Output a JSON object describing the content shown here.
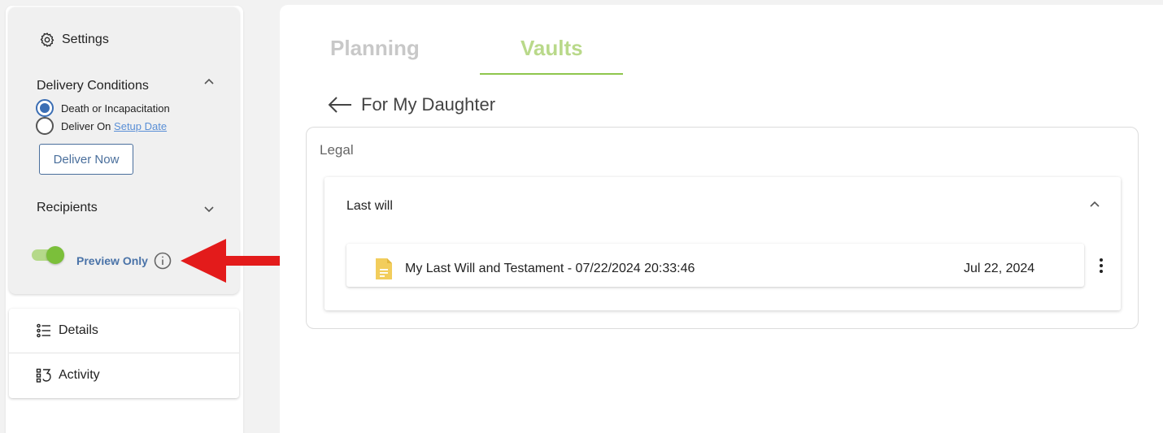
{
  "sidebar": {
    "settings_label": "Settings",
    "delivery_conditions": {
      "title": "Delivery Conditions",
      "options": [
        {
          "label": "Death or Incapacitation",
          "selected": true
        },
        {
          "label": "Deliver On",
          "link_label": "Setup Date",
          "selected": false
        }
      ],
      "deliver_now_label": "Deliver Now"
    },
    "recipients_label": "Recipients",
    "preview_toggle": {
      "label": "Preview Only",
      "on": true
    },
    "nav": [
      {
        "label": "Details",
        "icon": "details-list-icon"
      },
      {
        "label": "Activity",
        "icon": "activity-icon"
      }
    ]
  },
  "main": {
    "tabs": [
      {
        "label": "Planning",
        "active": false
      },
      {
        "label": "Vaults",
        "active": true
      }
    ],
    "vault_title": "For My Daughter",
    "section": {
      "title": "Legal",
      "category": {
        "title": "Last will",
        "files": [
          {
            "name": "My Last Will and Testament - 07/22/2024 20:33:46",
            "date": "Jul 22, 2024",
            "icon": "document-icon"
          }
        ]
      }
    }
  },
  "colors": {
    "accent_green": "#8fc64d",
    "link_blue": "#5a8fd6",
    "button_blue": "#4a6f9c",
    "annotation_red": "#e31b1b",
    "file_icon_yellow": "#f2cd5c"
  }
}
